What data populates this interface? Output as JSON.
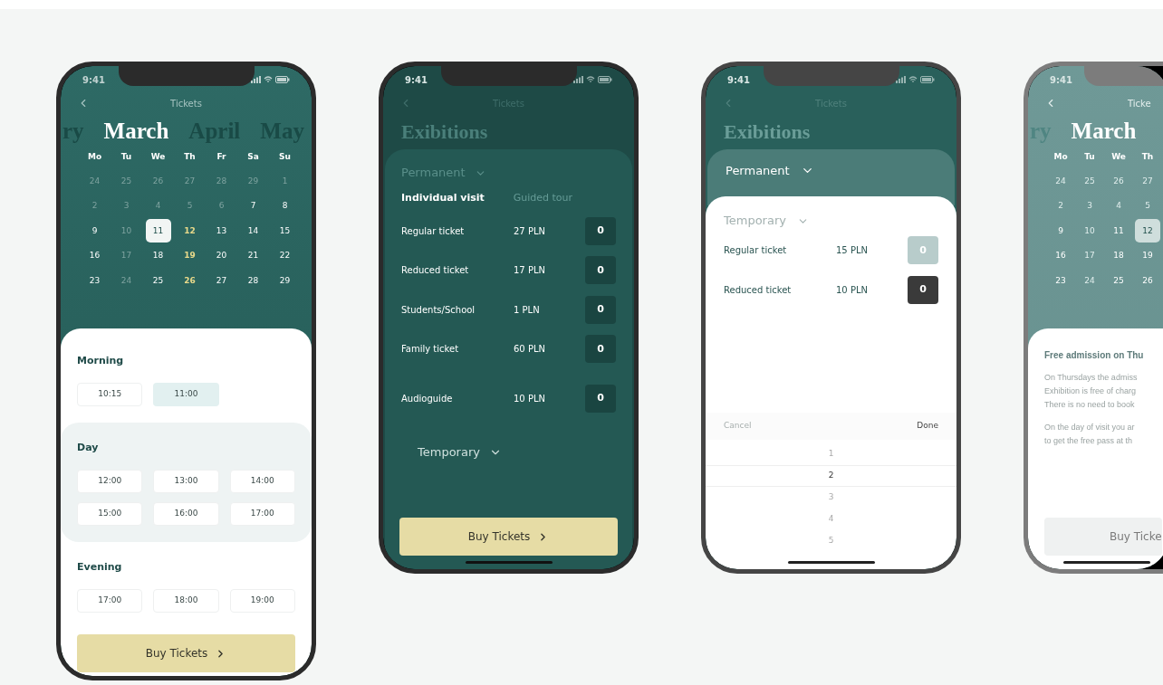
{
  "phones": [
    {
      "kind": "calendar-times",
      "status_time": "9:41",
      "nav_title": "Tickets",
      "months": [
        {
          "label": "ry",
          "selected": false
        },
        {
          "label": "March",
          "selected": true
        },
        {
          "label": "April",
          "selected": false
        },
        {
          "label": "May",
          "selected": false
        }
      ],
      "weekdays": [
        "Mo",
        "Tu",
        "We",
        "Th",
        "Fr",
        "Sa",
        "Su"
      ],
      "weeks": [
        [
          {
            "label": "24",
            "muted": true,
            "accent": false,
            "selected": false
          },
          {
            "label": "25",
            "muted": true,
            "accent": false,
            "selected": false
          },
          {
            "label": "26",
            "muted": true,
            "accent": false,
            "selected": false
          },
          {
            "label": "27",
            "muted": true,
            "accent": false,
            "selected": false
          },
          {
            "label": "28",
            "muted": true,
            "accent": false,
            "selected": false
          },
          {
            "label": "29",
            "muted": true,
            "accent": false,
            "selected": false
          },
          {
            "label": "1",
            "muted": true,
            "accent": false,
            "selected": false
          }
        ],
        [
          {
            "label": "2",
            "muted": true,
            "accent": false,
            "selected": false
          },
          {
            "label": "3",
            "muted": true,
            "accent": false,
            "selected": false
          },
          {
            "label": "4",
            "muted": true,
            "accent": false,
            "selected": false
          },
          {
            "label": "5",
            "muted": true,
            "accent": false,
            "selected": false
          },
          {
            "label": "6",
            "muted": true,
            "accent": false,
            "selected": false
          },
          {
            "label": "7",
            "muted": false,
            "accent": false,
            "selected": false
          },
          {
            "label": "8",
            "muted": false,
            "accent": false,
            "selected": false
          }
        ],
        [
          {
            "label": "9",
            "muted": false,
            "accent": false,
            "selected": false
          },
          {
            "label": "10",
            "muted": true,
            "accent": false,
            "selected": false
          },
          {
            "label": "11",
            "muted": false,
            "accent": false,
            "selected": true
          },
          {
            "label": "12",
            "muted": false,
            "accent": true,
            "selected": false
          },
          {
            "label": "13",
            "muted": false,
            "accent": false,
            "selected": false
          },
          {
            "label": "14",
            "muted": false,
            "accent": false,
            "selected": false
          },
          {
            "label": "15",
            "muted": false,
            "accent": false,
            "selected": false
          }
        ],
        [
          {
            "label": "16",
            "muted": false,
            "accent": false,
            "selected": false
          },
          {
            "label": "17",
            "muted": true,
            "accent": false,
            "selected": false
          },
          {
            "label": "18",
            "muted": false,
            "accent": false,
            "selected": false
          },
          {
            "label": "19",
            "muted": false,
            "accent": true,
            "selected": false
          },
          {
            "label": "20",
            "muted": false,
            "accent": false,
            "selected": false
          },
          {
            "label": "21",
            "muted": false,
            "accent": false,
            "selected": false
          },
          {
            "label": "22",
            "muted": false,
            "accent": false,
            "selected": false
          }
        ],
        [
          {
            "label": "23",
            "muted": false,
            "accent": false,
            "selected": false
          },
          {
            "label": "24",
            "muted": true,
            "accent": false,
            "selected": false
          },
          {
            "label": "25",
            "muted": false,
            "accent": false,
            "selected": false
          },
          {
            "label": "26",
            "muted": false,
            "accent": true,
            "selected": false
          },
          {
            "label": "27",
            "muted": false,
            "accent": false,
            "selected": false
          },
          {
            "label": "28",
            "muted": false,
            "accent": false,
            "selected": false
          },
          {
            "label": "29",
            "muted": false,
            "accent": false,
            "selected": false
          }
        ]
      ],
      "sections": [
        {
          "title": "Morning",
          "shaded": false,
          "slots": [
            {
              "label": "10:15",
              "selected": false
            },
            {
              "label": "11:00",
              "selected": true
            }
          ]
        },
        {
          "title": "Day",
          "shaded": true,
          "slots": [
            {
              "label": "12:00",
              "selected": false
            },
            {
              "label": "13:00",
              "selected": false
            },
            {
              "label": "14:00",
              "selected": false
            },
            {
              "label": "15:00",
              "selected": false
            },
            {
              "label": "16:00",
              "selected": false
            },
            {
              "label": "17:00",
              "selected": false
            }
          ]
        },
        {
          "title": "Evening",
          "shaded": false,
          "slots": [
            {
              "label": "17:00",
              "selected": false
            },
            {
              "label": "18:00",
              "selected": false
            },
            {
              "label": "19:00",
              "selected": false
            }
          ]
        }
      ],
      "button": "Buy Tickets"
    },
    {
      "kind": "tickets",
      "status_time": "9:41",
      "nav_title": "Tickets",
      "title": "Exibitions",
      "permanent": "Permanent",
      "tabs": [
        {
          "label": "Individual visit",
          "selected": true
        },
        {
          "label": "Guided tour",
          "selected": false
        }
      ],
      "rows": [
        {
          "name": "Regular ticket",
          "price": "27 PLN",
          "count": "0"
        },
        {
          "name": "Reduced ticket",
          "price": "17 PLN",
          "count": "0"
        },
        {
          "name": "Students/School",
          "price": "1 PLN",
          "count": "0"
        },
        {
          "name": "Family ticket",
          "price": "60 PLN",
          "count": "0"
        },
        {
          "name": "Audioguide",
          "price": "10 PLN",
          "count": "0"
        }
      ],
      "temporary": "Temporary",
      "button": "Buy Tickets"
    },
    {
      "kind": "picker",
      "status_time": "9:41",
      "nav_title": "Tickets",
      "title": "Exibitions",
      "permanent": "Permanent",
      "temporary": "Temporary",
      "rows": [
        {
          "name": "Regular ticket",
          "price": "15 PLN",
          "count": "0",
          "focused": false
        },
        {
          "name": "Reduced ticket",
          "price": "10 PLN",
          "count": "0",
          "focused": true
        }
      ],
      "picker": {
        "cancel": "Cancel",
        "done": "Done",
        "options": [
          {
            "label": "1",
            "selected": false
          },
          {
            "label": "2",
            "selected": true
          },
          {
            "label": "3",
            "selected": false
          },
          {
            "label": "4",
            "selected": false
          },
          {
            "label": "5",
            "selected": false
          }
        ]
      }
    },
    {
      "kind": "calendar-info",
      "status_time": "9:41",
      "nav_title": "Ticke",
      "months": [
        {
          "label": "ry",
          "selected": false
        },
        {
          "label": "March",
          "selected": true
        }
      ],
      "weekdays": [
        "Mo",
        "Tu",
        "We",
        "Th"
      ],
      "weeks": [
        [
          {
            "label": "24",
            "muted": true,
            "accent": false,
            "selected": false
          },
          {
            "label": "25",
            "muted": true,
            "accent": false,
            "selected": false
          },
          {
            "label": "26",
            "muted": true,
            "accent": false,
            "selected": false
          },
          {
            "label": "27",
            "muted": true,
            "accent": false,
            "selected": false
          }
        ],
        [
          {
            "label": "2",
            "muted": true,
            "accent": false,
            "selected": false
          },
          {
            "label": "3",
            "muted": true,
            "accent": false,
            "selected": false
          },
          {
            "label": "4",
            "muted": true,
            "accent": false,
            "selected": false
          },
          {
            "label": "5",
            "muted": true,
            "accent": false,
            "selected": false
          }
        ],
        [
          {
            "label": "9",
            "muted": false,
            "accent": false,
            "selected": false
          },
          {
            "label": "10",
            "muted": true,
            "accent": false,
            "selected": false
          },
          {
            "label": "11",
            "muted": false,
            "accent": false,
            "selected": false
          },
          {
            "label": "12",
            "muted": false,
            "accent": false,
            "selected": true
          }
        ],
        [
          {
            "label": "16",
            "muted": false,
            "accent": false,
            "selected": false
          },
          {
            "label": "17",
            "muted": true,
            "accent": false,
            "selected": false
          },
          {
            "label": "18",
            "muted": false,
            "accent": false,
            "selected": false
          },
          {
            "label": "19",
            "muted": false,
            "accent": false,
            "selected": false
          }
        ],
        [
          {
            "label": "23",
            "muted": false,
            "accent": false,
            "selected": false
          },
          {
            "label": "24",
            "muted": true,
            "accent": false,
            "selected": false
          },
          {
            "label": "25",
            "muted": false,
            "accent": false,
            "selected": false
          },
          {
            "label": "26",
            "muted": false,
            "accent": false,
            "selected": false
          }
        ]
      ],
      "info_title": "Free admission on Thu",
      "paragraphs": [
        [
          "On Thursdays the admiss",
          "Exhibition is free of charg",
          "There is no need to book"
        ],
        [
          "On the day of visit you ar",
          "to get the free pass at th"
        ]
      ],
      "button": "Buy Ticke"
    }
  ]
}
